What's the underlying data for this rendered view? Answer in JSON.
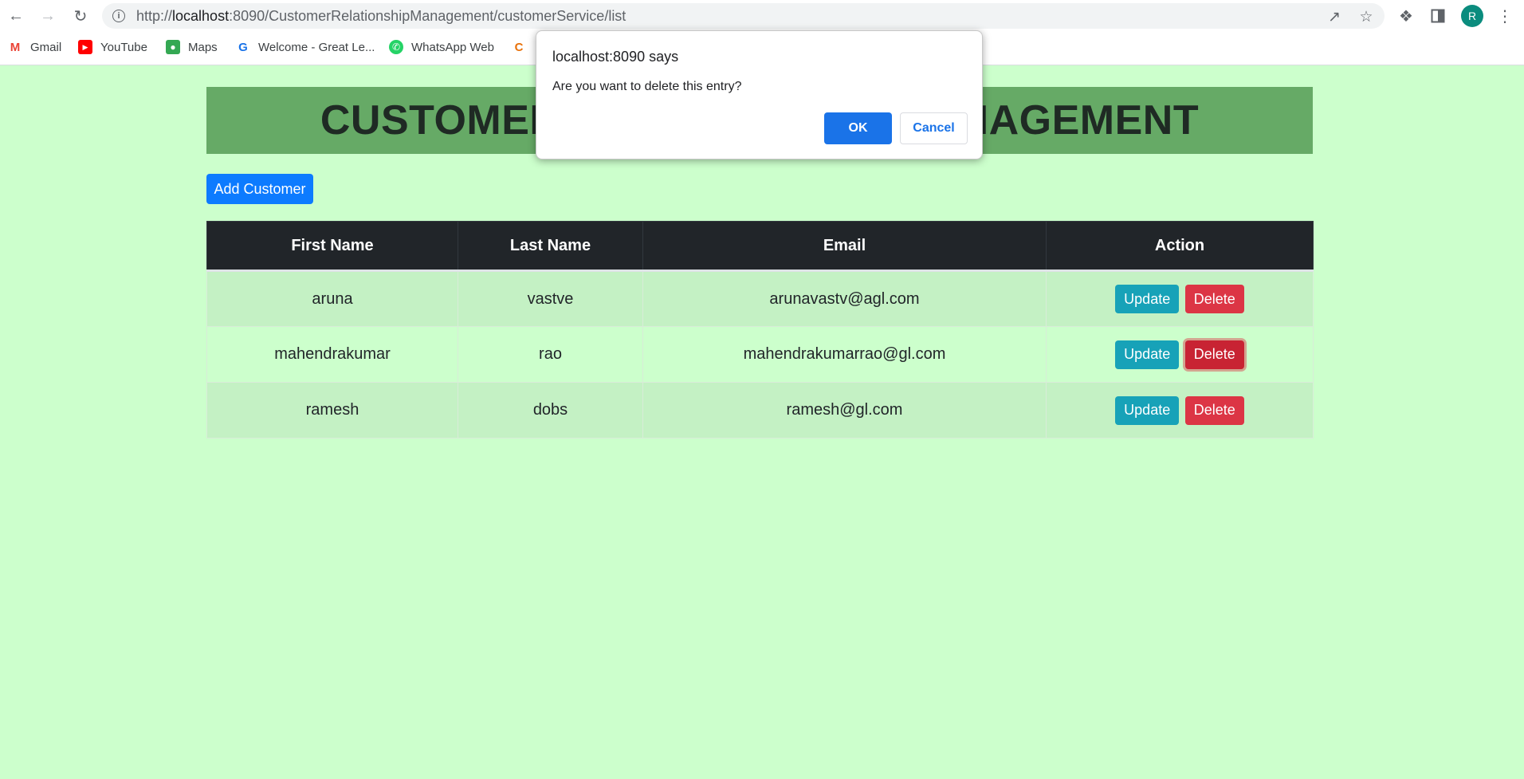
{
  "browser": {
    "url_prefix": "http://",
    "url_host": "localhost",
    "url_rest": ":8090/CustomerRelationshipManagement/customerService/list",
    "profile_initial": "R",
    "bookmarks": [
      {
        "label": "Gmail",
        "icon": "gmail-icon"
      },
      {
        "label": "YouTube",
        "icon": "youtube-icon"
      },
      {
        "label": "Maps",
        "icon": "maps-icon"
      },
      {
        "label": "Welcome - Great Le...",
        "icon": "great-learning-icon"
      },
      {
        "label": "WhatsApp Web",
        "icon": "whatsapp-icon"
      },
      {
        "label": "",
        "icon": "bookmark-site-icon"
      }
    ]
  },
  "page": {
    "title": "CUSTOMER RELATIONSHIP MANAGEMENT",
    "add_button": "Add Customer",
    "table": {
      "headers": [
        "First Name",
        "Last Name",
        "Email",
        "Action"
      ],
      "rows": [
        {
          "first": "aruna",
          "last": "vastve",
          "email": "arunavastv@agl.com"
        },
        {
          "first": "mahendrakumar",
          "last": "rao",
          "email": "mahendrakumarrao@gl.com"
        },
        {
          "first": "ramesh",
          "last": "dobs",
          "email": "ramesh@gl.com"
        }
      ],
      "update_label": "Update",
      "delete_label": "Delete"
    }
  },
  "dialog": {
    "title": "localhost:8090 says",
    "message": "Are you want to delete this entry?",
    "ok": "OK",
    "cancel": "Cancel"
  },
  "colors": {
    "page_bg": "#ccffcc",
    "banner_bg": "#66aa66",
    "primary": "#0d7bff",
    "update": "#17a2b8",
    "delete": "#dc3545",
    "table_header": "#212529"
  }
}
